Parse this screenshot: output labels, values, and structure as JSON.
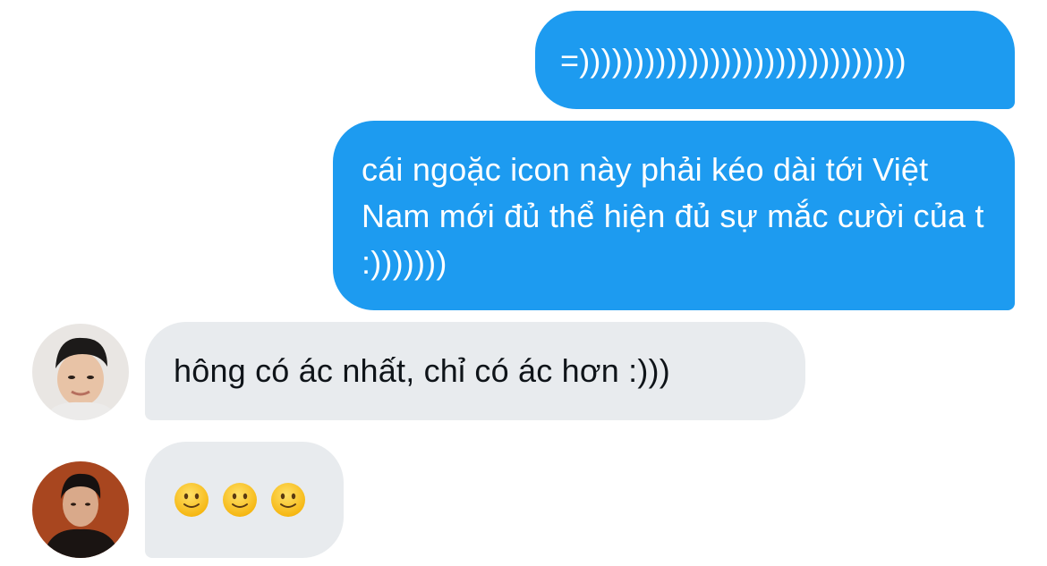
{
  "conversation": {
    "messages": [
      {
        "from": "me",
        "text": "=))))))))))))))))))))))))))))))"
      },
      {
        "from": "me",
        "text": "cái ngoặc icon này phải kéo dài tới Việt Nam mới đủ thể hiện đủ sự mắc cười của t :)))))))"
      },
      {
        "from": "other",
        "text": "hông có ác nhất, chỉ có ác hơn :)))"
      },
      {
        "from": "other",
        "emojis": [
          "slightly-smiling-face",
          "slightly-smiling-face",
          "slightly-smiling-face"
        ]
      }
    ]
  },
  "colors": {
    "sent_bubble": "#1d9bf0",
    "received_bubble": "#e8ebee",
    "background": "#ffffff"
  },
  "icons": {
    "emoji": "slightly-smiling-face"
  }
}
